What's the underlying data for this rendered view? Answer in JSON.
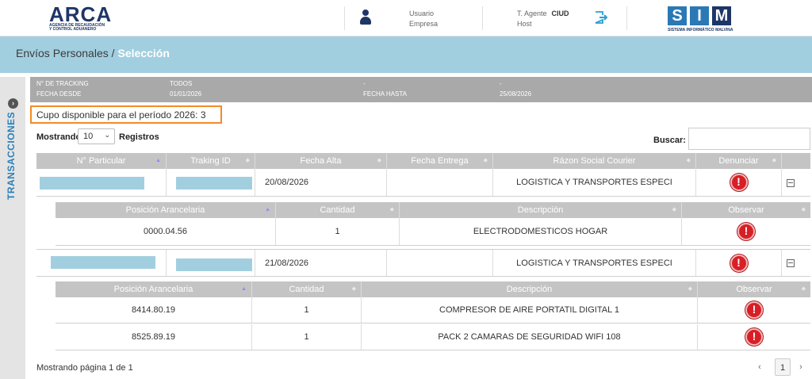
{
  "header": {
    "brand": "ARCA",
    "brand_sub1": "AGENCIA DE RECAUDACIÓN",
    "brand_sub2": "Y CONTROL ADUANERO",
    "usuario_label": "Usuario",
    "empresa_label": "Empresa",
    "agente_label": "T. Agente",
    "agente_value": "CIUD",
    "host_label": "Host",
    "sim_letters": [
      "S",
      "I",
      "M"
    ],
    "sim_sub": "SISTEMA INFORMÁTICO MALVINA"
  },
  "title": {
    "section": "Envíos Personales /",
    "current": "Selección"
  },
  "side": {
    "tab_label": "TRANSACCIONES"
  },
  "filters": {
    "tracking_label": "N° DE TRACKING",
    "tracking_value": "TODOS",
    "dash1": "-",
    "dash2": "-",
    "fecha_desde_label": "FECHA DESDE",
    "fecha_desde_value": "01/01/2026",
    "fecha_hasta_label": "FECHA HASTA",
    "fecha_hasta_value": "25/08/2026"
  },
  "cupo": "Cupo disponible para el período 2026: 3",
  "controls": {
    "mostrando": "Mostrando",
    "page_size": "10",
    "registros": "Registros",
    "buscar": "Buscar:"
  },
  "main_table": {
    "headers": [
      "N° Particular",
      "Traking ID",
      "Fecha Alta",
      "Fecha Entrega",
      "Rázon Social Courier",
      "Denunciar"
    ],
    "rows": [
      {
        "fecha_alta": "20/08/2026",
        "fecha_entrega": "",
        "courier": "LOGISTICA Y TRANSPORTES ESPECI"
      },
      {
        "fecha_alta": "21/08/2026",
        "fecha_entrega": "",
        "courier": "LOGISTICA Y TRANSPORTES ESPECI"
      }
    ]
  },
  "sub_tables": [
    {
      "headers": [
        "Posición Arancelaria",
        "Cantidad",
        "Descripción",
        "Observar"
      ],
      "rows": [
        {
          "posicion": "0000.04.56",
          "cantidad": "1",
          "descripcion": "ELECTRODOMESTICOS HOGAR"
        }
      ]
    },
    {
      "headers": [
        "Posición Arancelaria",
        "Cantidad",
        "Descripción",
        "Observar"
      ],
      "rows": [
        {
          "posicion": "8414.80.19",
          "cantidad": "1",
          "descripcion": "COMPRESOR DE AIRE PORTATIL DIGITAL 1"
        },
        {
          "posicion": "8525.89.19",
          "cantidad": "1",
          "descripcion": "PACK 2 CAMARAS DE SEGURIDAD WIFI 108"
        }
      ]
    }
  ],
  "alert_glyph": "!",
  "footer": {
    "paging_text": "Mostrando página 1 de 1",
    "prev": "‹",
    "page": "1",
    "next": "›"
  },
  "colors": {
    "title_bar": "#a2cfe0",
    "brand": "#1d3666",
    "sim_blue": "#2a79b5",
    "highlight_border": "#f28c28",
    "alert_red": "#d81f26",
    "redacted": "#a2cfe0"
  }
}
